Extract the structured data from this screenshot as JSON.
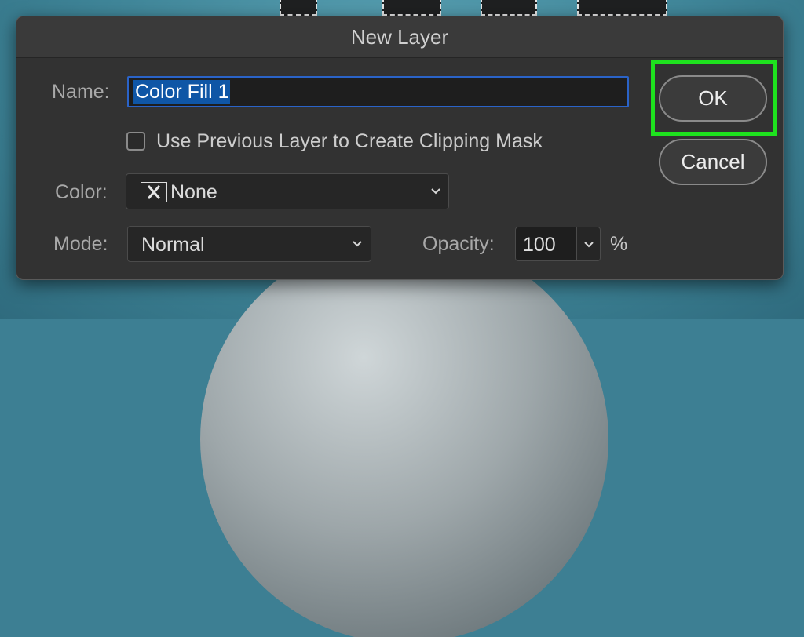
{
  "dialog": {
    "title": "New Layer",
    "name_label": "Name:",
    "name_value": "Color Fill 1",
    "clipping_label": "Use Previous Layer to Create Clipping Mask",
    "clipping_checked": false,
    "color_label": "Color:",
    "color_value": "None",
    "mode_label": "Mode:",
    "mode_value": "Normal",
    "opacity_label": "Opacity:",
    "opacity_value": "100",
    "opacity_unit": "%",
    "ok_label": "OK",
    "cancel_label": "Cancel"
  },
  "icons": {
    "color_swatch": "none-swatch-icon",
    "dropdown": "chevron-down-icon"
  },
  "colors": {
    "highlight": "#1ee21e",
    "selection": "#0f56a6",
    "focus_border": "#2a63c8",
    "dialog_bg": "#323232"
  }
}
